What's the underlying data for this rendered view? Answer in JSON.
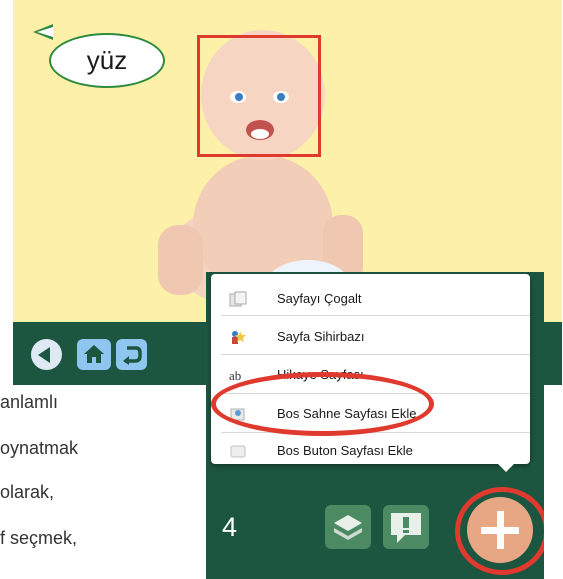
{
  "scene": {
    "caption": "yüz"
  },
  "popup_menu": {
    "items": [
      {
        "label": "Sayfayı Çogalt",
        "icon": "copy-icon"
      },
      {
        "label": "Sayfa Sihirbazı",
        "icon": "wizard-icon"
      },
      {
        "label": "Hikaye Sayfası",
        "icon": "text-icon"
      },
      {
        "label": "Bos Sahne Sayfası Ekle",
        "icon": "scene-icon"
      },
      {
        "label": "Bos Buton Sayfası Ekle",
        "icon": "button-page-icon"
      }
    ]
  },
  "toolbar": {
    "page_number": "4",
    "add_icon": "plus-icon"
  },
  "paragraph": {
    "lines": [
      "anlamlı",
      "oynatmak",
      "olarak,",
      "f seçmek,"
    ]
  },
  "colors": {
    "highlight": "#e03a2f",
    "toolbar": "#1d5640",
    "background": "#fdf0a8"
  }
}
